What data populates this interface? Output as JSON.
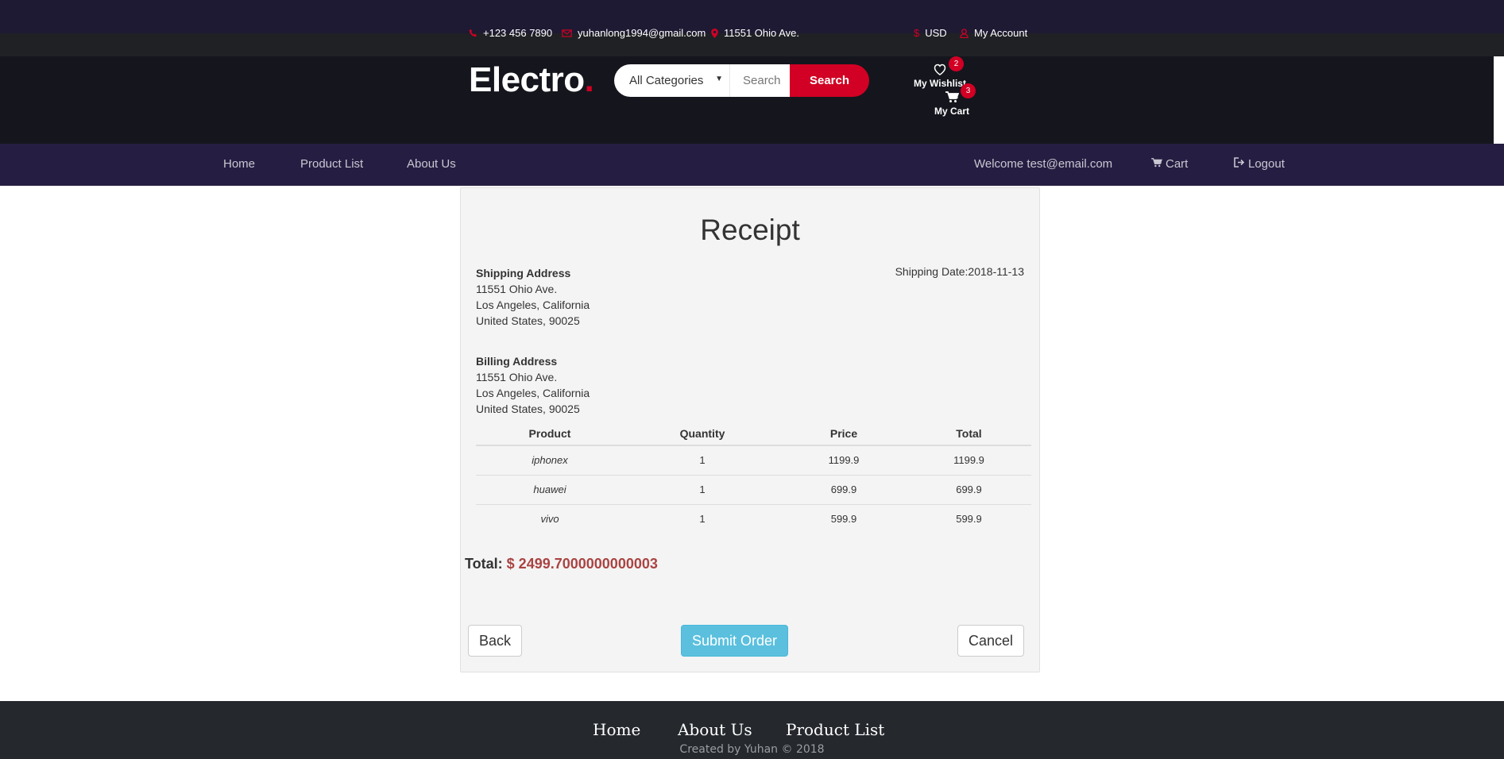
{
  "top_header": {
    "phone": "+123 456 7890",
    "email": "yuhanlong1994@gmail.com",
    "address": "11551 Ohio Ave.",
    "currency": "USD",
    "account": "My Account"
  },
  "header": {
    "logo": "Electro",
    "logo_dot": ".",
    "category": "All Categories",
    "search_placeholder": "Search",
    "search_button": "Search",
    "wishlist_label": "My Wishlist",
    "wishlist_count": "2",
    "cart_label": "My Cart",
    "cart_count": "3"
  },
  "nav": {
    "left": [
      "Home",
      "Product List",
      "About Us"
    ],
    "welcome": "Welcome test@email.com",
    "cart": "Cart",
    "logout": "Logout"
  },
  "receipt": {
    "title": "Receipt",
    "shipping": {
      "heading": "Shipping Address",
      "line1": "11551 Ohio Ave.",
      "line2": "Los Angeles, California",
      "line3": "United States, 90025"
    },
    "shipping_date": "Shipping Date:2018-11-13",
    "billing": {
      "heading": "Billing Address",
      "line1": "11551 Ohio Ave.",
      "line2": "Los Angeles, California",
      "line3": "United States, 90025"
    },
    "columns": [
      "Product",
      "Quantity",
      "Price",
      "Total"
    ],
    "items": [
      {
        "product": "iphonex",
        "quantity": "1",
        "price": "1199.9",
        "total": "1199.9"
      },
      {
        "product": "huawei",
        "quantity": "1",
        "price": "699.9",
        "total": "699.9"
      },
      {
        "product": "vivo",
        "quantity": "1",
        "price": "599.9",
        "total": "599.9"
      }
    ],
    "total_label": "Total:",
    "total_amount": "$ 2499.7000000000003",
    "back": "Back",
    "submit": "Submit Order",
    "cancel": "Cancel"
  },
  "footer": {
    "links": [
      "Home",
      "About Us",
      "Product List"
    ],
    "credit": "Created by Yuhan © 2018"
  },
  "colors": {
    "accent": "#d10024",
    "top_bar": "#1e1a33",
    "header_bg": "#15161d",
    "nav_bg": "#261e42",
    "panel_bg": "#f4f4f4",
    "submit_bg": "#5bc0de",
    "footer_bg": "#25292e"
  }
}
